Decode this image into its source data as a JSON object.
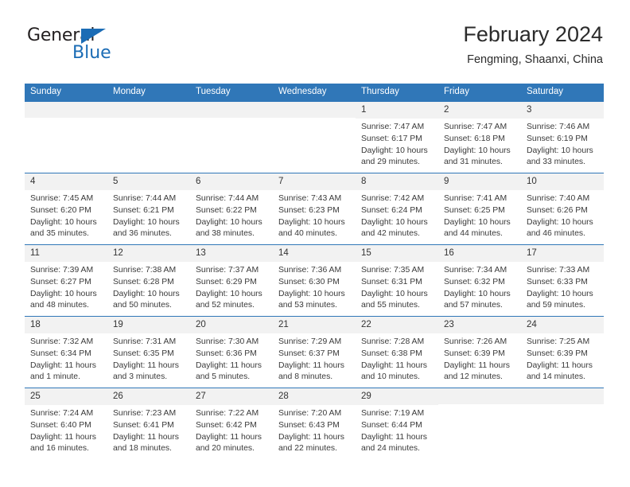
{
  "brand": {
    "word_one": "General",
    "word_two": "Blue",
    "accent_color": "#1b6cb5"
  },
  "header": {
    "title": "February 2024",
    "location": "Fengming, Shaanxi, China"
  },
  "theme": {
    "header_blue": "#3077b8",
    "date_band": "#f2f2f2",
    "text": "#3a3a3a"
  },
  "weekdays": [
    "Sunday",
    "Monday",
    "Tuesday",
    "Wednesday",
    "Thursday",
    "Friday",
    "Saturday"
  ],
  "labels": {
    "sunrise": "Sunrise:",
    "sunset": "Sunset:",
    "daylight": "Daylight:"
  },
  "weeks": [
    [
      {
        "day": "",
        "sunrise": "",
        "sunset": "",
        "daylight_1": "",
        "daylight_2": ""
      },
      {
        "day": "",
        "sunrise": "",
        "sunset": "",
        "daylight_1": "",
        "daylight_2": ""
      },
      {
        "day": "",
        "sunrise": "",
        "sunset": "",
        "daylight_1": "",
        "daylight_2": ""
      },
      {
        "day": "",
        "sunrise": "",
        "sunset": "",
        "daylight_1": "",
        "daylight_2": ""
      },
      {
        "day": "1",
        "sunrise": "Sunrise: 7:47 AM",
        "sunset": "Sunset: 6:17 PM",
        "daylight_1": "Daylight: 10 hours",
        "daylight_2": "and 29 minutes."
      },
      {
        "day": "2",
        "sunrise": "Sunrise: 7:47 AM",
        "sunset": "Sunset: 6:18 PM",
        "daylight_1": "Daylight: 10 hours",
        "daylight_2": "and 31 minutes."
      },
      {
        "day": "3",
        "sunrise": "Sunrise: 7:46 AM",
        "sunset": "Sunset: 6:19 PM",
        "daylight_1": "Daylight: 10 hours",
        "daylight_2": "and 33 minutes."
      }
    ],
    [
      {
        "day": "4",
        "sunrise": "Sunrise: 7:45 AM",
        "sunset": "Sunset: 6:20 PM",
        "daylight_1": "Daylight: 10 hours",
        "daylight_2": "and 35 minutes."
      },
      {
        "day": "5",
        "sunrise": "Sunrise: 7:44 AM",
        "sunset": "Sunset: 6:21 PM",
        "daylight_1": "Daylight: 10 hours",
        "daylight_2": "and 36 minutes."
      },
      {
        "day": "6",
        "sunrise": "Sunrise: 7:44 AM",
        "sunset": "Sunset: 6:22 PM",
        "daylight_1": "Daylight: 10 hours",
        "daylight_2": "and 38 minutes."
      },
      {
        "day": "7",
        "sunrise": "Sunrise: 7:43 AM",
        "sunset": "Sunset: 6:23 PM",
        "daylight_1": "Daylight: 10 hours",
        "daylight_2": "and 40 minutes."
      },
      {
        "day": "8",
        "sunrise": "Sunrise: 7:42 AM",
        "sunset": "Sunset: 6:24 PM",
        "daylight_1": "Daylight: 10 hours",
        "daylight_2": "and 42 minutes."
      },
      {
        "day": "9",
        "sunrise": "Sunrise: 7:41 AM",
        "sunset": "Sunset: 6:25 PM",
        "daylight_1": "Daylight: 10 hours",
        "daylight_2": "and 44 minutes."
      },
      {
        "day": "10",
        "sunrise": "Sunrise: 7:40 AM",
        "sunset": "Sunset: 6:26 PM",
        "daylight_1": "Daylight: 10 hours",
        "daylight_2": "and 46 minutes."
      }
    ],
    [
      {
        "day": "11",
        "sunrise": "Sunrise: 7:39 AM",
        "sunset": "Sunset: 6:27 PM",
        "daylight_1": "Daylight: 10 hours",
        "daylight_2": "and 48 minutes."
      },
      {
        "day": "12",
        "sunrise": "Sunrise: 7:38 AM",
        "sunset": "Sunset: 6:28 PM",
        "daylight_1": "Daylight: 10 hours",
        "daylight_2": "and 50 minutes."
      },
      {
        "day": "13",
        "sunrise": "Sunrise: 7:37 AM",
        "sunset": "Sunset: 6:29 PM",
        "daylight_1": "Daylight: 10 hours",
        "daylight_2": "and 52 minutes."
      },
      {
        "day": "14",
        "sunrise": "Sunrise: 7:36 AM",
        "sunset": "Sunset: 6:30 PM",
        "daylight_1": "Daylight: 10 hours",
        "daylight_2": "and 53 minutes."
      },
      {
        "day": "15",
        "sunrise": "Sunrise: 7:35 AM",
        "sunset": "Sunset: 6:31 PM",
        "daylight_1": "Daylight: 10 hours",
        "daylight_2": "and 55 minutes."
      },
      {
        "day": "16",
        "sunrise": "Sunrise: 7:34 AM",
        "sunset": "Sunset: 6:32 PM",
        "daylight_1": "Daylight: 10 hours",
        "daylight_2": "and 57 minutes."
      },
      {
        "day": "17",
        "sunrise": "Sunrise: 7:33 AM",
        "sunset": "Sunset: 6:33 PM",
        "daylight_1": "Daylight: 10 hours",
        "daylight_2": "and 59 minutes."
      }
    ],
    [
      {
        "day": "18",
        "sunrise": "Sunrise: 7:32 AM",
        "sunset": "Sunset: 6:34 PM",
        "daylight_1": "Daylight: 11 hours",
        "daylight_2": "and 1 minute."
      },
      {
        "day": "19",
        "sunrise": "Sunrise: 7:31 AM",
        "sunset": "Sunset: 6:35 PM",
        "daylight_1": "Daylight: 11 hours",
        "daylight_2": "and 3 minutes."
      },
      {
        "day": "20",
        "sunrise": "Sunrise: 7:30 AM",
        "sunset": "Sunset: 6:36 PM",
        "daylight_1": "Daylight: 11 hours",
        "daylight_2": "and 5 minutes."
      },
      {
        "day": "21",
        "sunrise": "Sunrise: 7:29 AM",
        "sunset": "Sunset: 6:37 PM",
        "daylight_1": "Daylight: 11 hours",
        "daylight_2": "and 8 minutes."
      },
      {
        "day": "22",
        "sunrise": "Sunrise: 7:28 AM",
        "sunset": "Sunset: 6:38 PM",
        "daylight_1": "Daylight: 11 hours",
        "daylight_2": "and 10 minutes."
      },
      {
        "day": "23",
        "sunrise": "Sunrise: 7:26 AM",
        "sunset": "Sunset: 6:39 PM",
        "daylight_1": "Daylight: 11 hours",
        "daylight_2": "and 12 minutes."
      },
      {
        "day": "24",
        "sunrise": "Sunrise: 7:25 AM",
        "sunset": "Sunset: 6:39 PM",
        "daylight_1": "Daylight: 11 hours",
        "daylight_2": "and 14 minutes."
      }
    ],
    [
      {
        "day": "25",
        "sunrise": "Sunrise: 7:24 AM",
        "sunset": "Sunset: 6:40 PM",
        "daylight_1": "Daylight: 11 hours",
        "daylight_2": "and 16 minutes."
      },
      {
        "day": "26",
        "sunrise": "Sunrise: 7:23 AM",
        "sunset": "Sunset: 6:41 PM",
        "daylight_1": "Daylight: 11 hours",
        "daylight_2": "and 18 minutes."
      },
      {
        "day": "27",
        "sunrise": "Sunrise: 7:22 AM",
        "sunset": "Sunset: 6:42 PM",
        "daylight_1": "Daylight: 11 hours",
        "daylight_2": "and 20 minutes."
      },
      {
        "day": "28",
        "sunrise": "Sunrise: 7:20 AM",
        "sunset": "Sunset: 6:43 PM",
        "daylight_1": "Daylight: 11 hours",
        "daylight_2": "and 22 minutes."
      },
      {
        "day": "29",
        "sunrise": "Sunrise: 7:19 AM",
        "sunset": "Sunset: 6:44 PM",
        "daylight_1": "Daylight: 11 hours",
        "daylight_2": "and 24 minutes."
      },
      {
        "day": "",
        "sunrise": "",
        "sunset": "",
        "daylight_1": "",
        "daylight_2": ""
      },
      {
        "day": "",
        "sunrise": "",
        "sunset": "",
        "daylight_1": "",
        "daylight_2": ""
      }
    ]
  ]
}
